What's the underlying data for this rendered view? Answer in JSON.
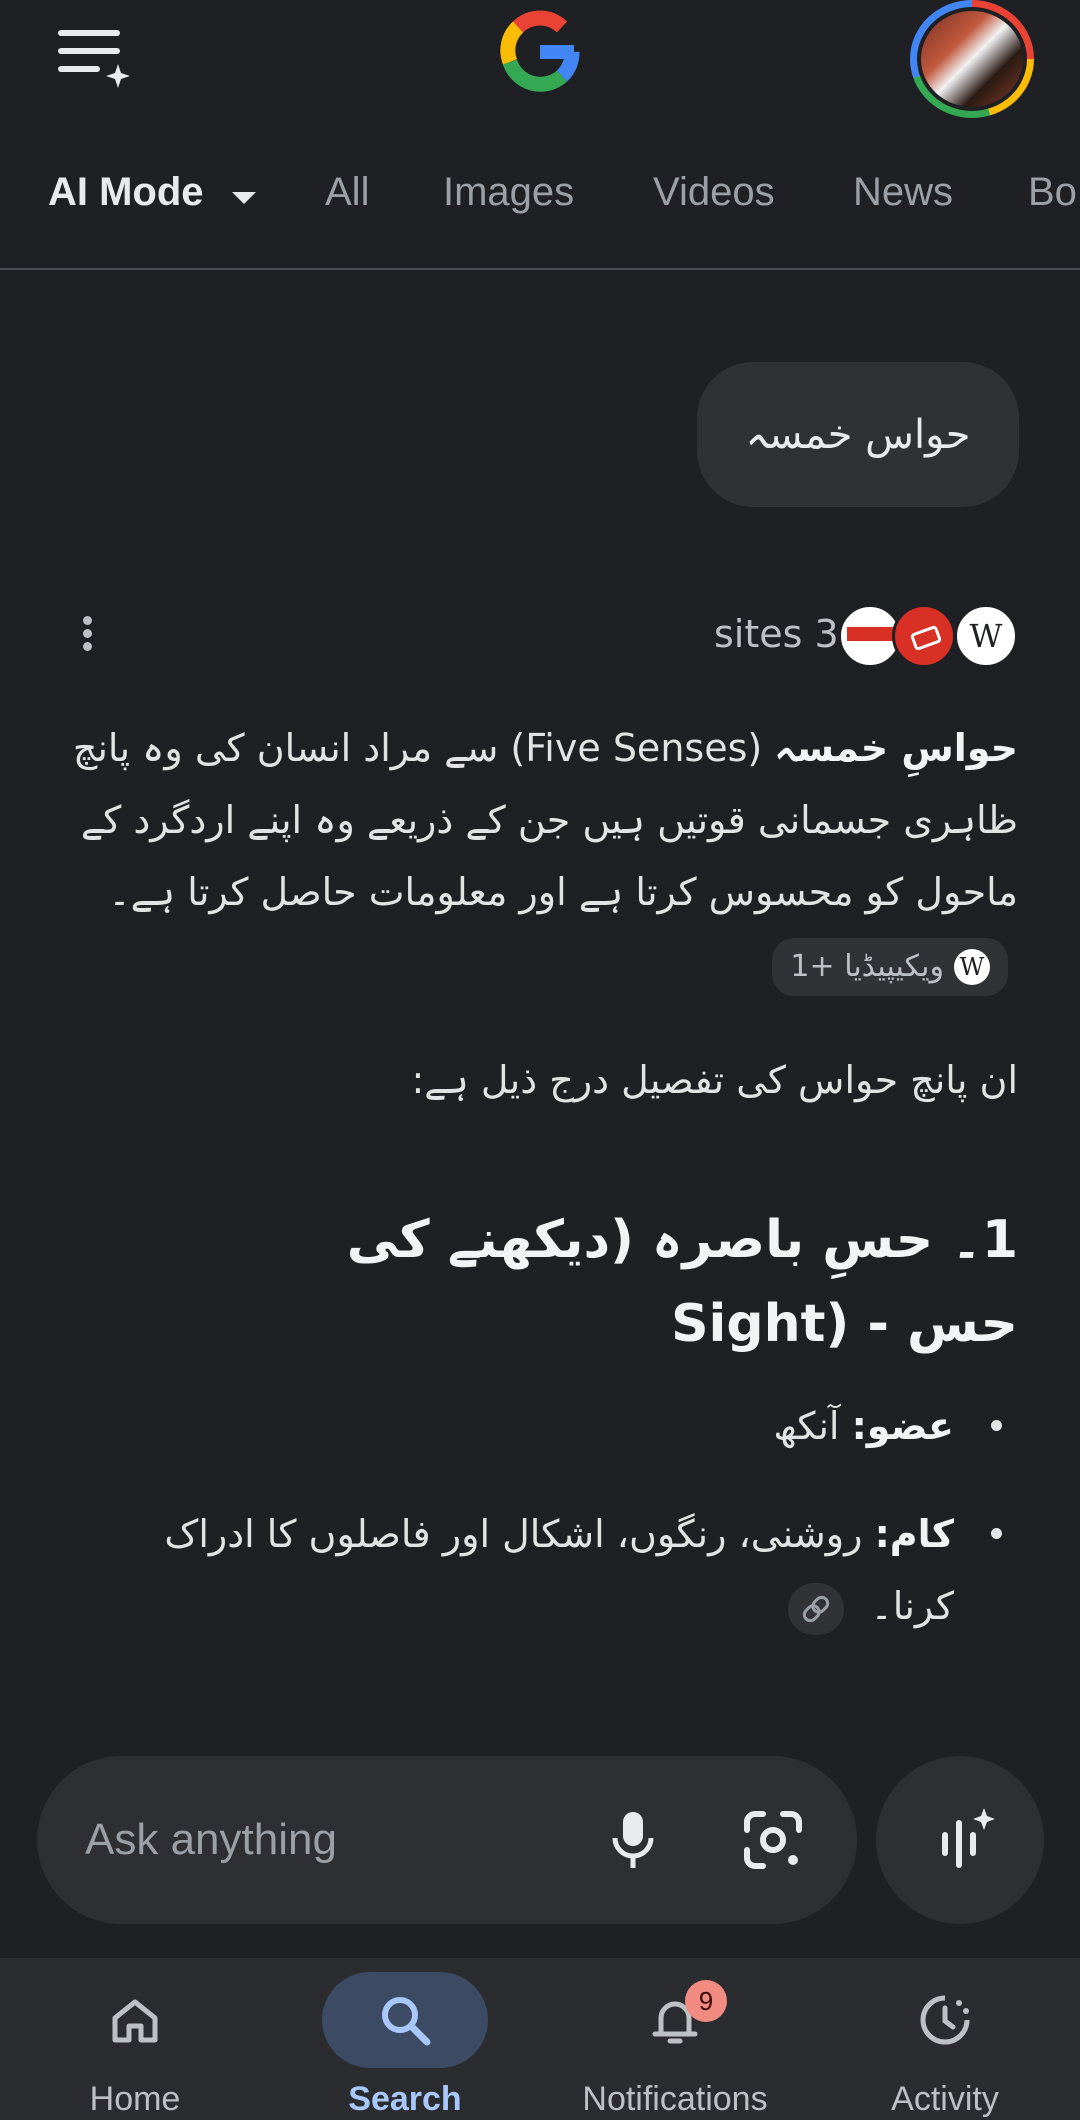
{
  "header": {
    "menu_icon": "menu-sparkle-icon",
    "logo": "google-g-logo",
    "avatar": "profile-avatar"
  },
  "tabs": [
    {
      "label": "AI Mode",
      "active": true
    },
    {
      "label": "All"
    },
    {
      "label": "Images"
    },
    {
      "label": "Videos"
    },
    {
      "label": "News"
    },
    {
      "label": "Bo"
    }
  ],
  "query": "حواس خمسہ",
  "sources": {
    "label": "sites 3",
    "icons": [
      "express-news-icon",
      "red-news-icon",
      "wikipedia-icon"
    ]
  },
  "answer": {
    "p1_bold": "حواسِ خمسہ",
    "p1_latin": "(Five Senses)",
    "p1_rest": "سے مراد انسان کی وہ پانچ ظاہری جسمانی قوتیں ہیں جن کے ذریعے وہ اپنے اردگرد کے ماحول کو محسوس کرتا ہے اور معلومات حاصل کرتا ہے۔",
    "citation_chip": "ویکیپیڈیا +1",
    "p2": "ان پانچ حواس کی تفصیل درج ذیل ہے:",
    "heading_main": "1۔ حسِ باصرہ (دیکھنے کی حس -",
    "heading_latin": "Sight)",
    "bullets": [
      {
        "term": "عضو:",
        "text": "آنکھ"
      },
      {
        "term": "کام:",
        "text": "روشنی، رنگوں، اشکال اور فاصلوں کا ادراک کرنا۔"
      }
    ]
  },
  "input": {
    "placeholder": "Ask anything"
  },
  "bottom_nav": [
    {
      "label": "Home",
      "icon": "home-icon"
    },
    {
      "label": "Search",
      "icon": "search-icon",
      "active": true
    },
    {
      "label": "Notifications",
      "icon": "bell-icon",
      "badge": "9"
    },
    {
      "label": "Activity",
      "icon": "activity-icon"
    }
  ],
  "colors": {
    "background": "#1f2023",
    "bubble": "#2f3134",
    "active_nav": "#3c4a63",
    "badge": "#f28b82"
  }
}
